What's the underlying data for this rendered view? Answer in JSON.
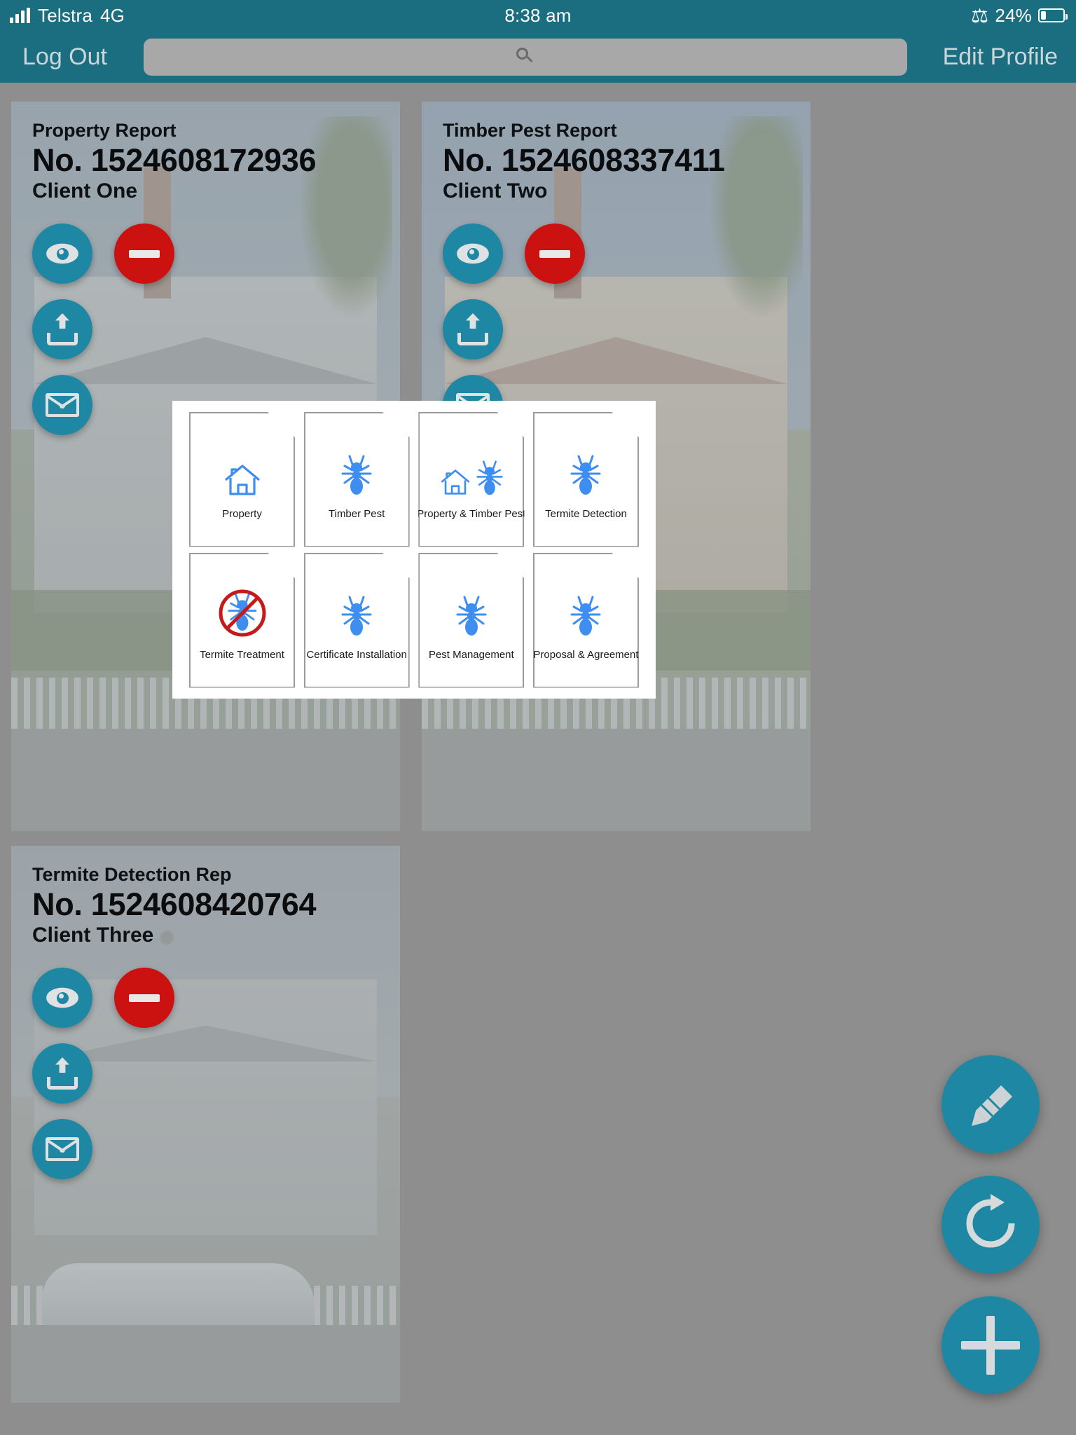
{
  "status_bar": {
    "carrier": "Telstra",
    "network": "4G",
    "time": "8:38 am",
    "battery_percent": "24%",
    "bluetooth_icon": "bluetooth-icon",
    "signal_icon": "signal-bars-icon",
    "battery_icon": "battery-icon"
  },
  "nav_bar": {
    "logout_label": "Log Out",
    "edit_profile_label": "Edit Profile",
    "search_placeholder": "",
    "search_value": "",
    "search_icon": "search-icon"
  },
  "theme": {
    "teal": "#1b6e80",
    "fab_teal": "#1e87a4",
    "red": "#cc1111",
    "doc_blue": "#3d8ef0",
    "no_sign_red": "#c61a1a",
    "page_bg": "#8e8e8e"
  },
  "reports": [
    {
      "type": "Property Report",
      "number": "No. 1524608172936",
      "client": "Client One",
      "actions": [
        "view",
        "delete",
        "upload",
        "email"
      ]
    },
    {
      "type": "Timber Pest Report",
      "number": "No. 1524608337411",
      "client": "Client Two",
      "actions": [
        "view",
        "delete",
        "upload",
        "email"
      ]
    },
    {
      "type": "Termite Detection Rep",
      "number": "No. 1524608420764",
      "client": "Client Three",
      "actions": [
        "view",
        "delete",
        "upload",
        "email"
      ]
    }
  ],
  "fabs": [
    {
      "name": "edit-fab",
      "icon": "pencil-icon"
    },
    {
      "name": "refresh-fab",
      "icon": "refresh-icon"
    },
    {
      "name": "add-fab",
      "icon": "plus-icon"
    }
  ],
  "report_type_modal": {
    "rows": [
      [
        {
          "label": "Property",
          "icon": "house-icon"
        },
        {
          "label": "Timber Pest",
          "icon": "ant-icon"
        },
        {
          "label": "Property & Timber Pest",
          "icon": "house-and-ant-icon"
        },
        {
          "label": "Termite Detection",
          "icon": "ant-icon"
        }
      ],
      [
        {
          "label": "Termite Treatment",
          "icon": "ant-no-sign-icon"
        },
        {
          "label": "Certificate Installation",
          "icon": "ant-icon"
        },
        {
          "label": "Pest Management",
          "icon": "ant-icon"
        },
        {
          "label": "Proposal & Agreement",
          "icon": "ant-icon"
        }
      ]
    ]
  }
}
